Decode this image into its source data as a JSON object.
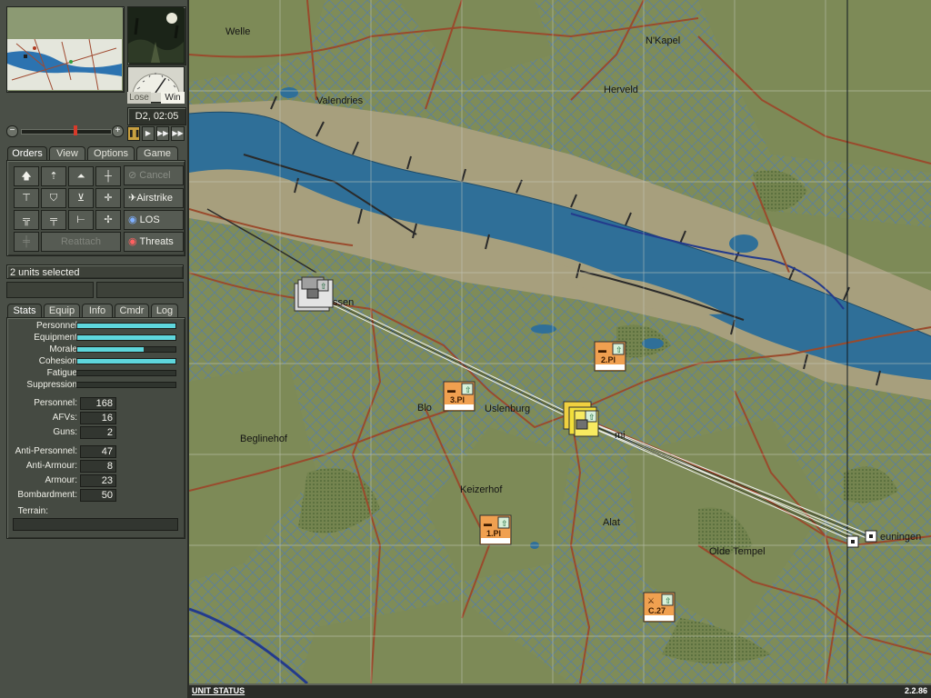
{
  "header": {
    "date_time": "D2, 02:05",
    "lose_label": "Lose",
    "win_label": "Win"
  },
  "speed_controls": [
    "pause",
    "play",
    "fast",
    "fastest"
  ],
  "main_tabs": [
    "Orders",
    "View",
    "Options",
    "Game"
  ],
  "orders": {
    "cancel": "Cancel",
    "airstrike": "Airstrike",
    "los": "LOS",
    "threats": "Threats",
    "reattach": "Reattach"
  },
  "selection": {
    "text": "2 units selected"
  },
  "unit_tabs": [
    "Stats",
    "Equip",
    "Info",
    "Cmdr",
    "Log"
  ],
  "stats_bars": [
    {
      "label": "Personnel",
      "value": 1.0
    },
    {
      "label": "Equipment",
      "value": 1.0
    },
    {
      "label": "Morale",
      "value": 0.68
    },
    {
      "label": "Cohesion",
      "value": 1.0
    },
    {
      "label": "Fatigue",
      "value": 0.0
    },
    {
      "label": "Suppression",
      "value": 0.0
    }
  ],
  "stats_values": [
    {
      "label": "Personnel:",
      "value": "168"
    },
    {
      "label": "AFVs:",
      "value": "16"
    },
    {
      "label": "Guns:",
      "value": "2"
    },
    {
      "label": "Anti-Personnel:",
      "value": "47"
    },
    {
      "label": "Anti-Armour:",
      "value": "8"
    },
    {
      "label": "Armour:",
      "value": "23"
    },
    {
      "label": "Bombardment:",
      "value": "50"
    }
  ],
  "terrain_label": "Terrain:",
  "map": {
    "places": [
      "Welle",
      "Valendries",
      "N'Kapel",
      "Herveld",
      "Blo",
      "Uslenburg",
      "Beglinehof",
      "Keizerhof",
      "Alat",
      "Olde Tempel",
      "euningen",
      "ssen",
      "mi"
    ],
    "units": [
      "1.Pl",
      "2.Pl",
      "3.Pl",
      "C.27"
    ]
  },
  "status_bar": {
    "label": "UNIT STATUS",
    "version": "2.2.86"
  },
  "colors": {
    "panel": "#4a4f47",
    "bar_fill": "#5ed6dc",
    "river": "#2f6f98",
    "road": "#9a4a2c",
    "unit_orange": "#f0a050",
    "unit_yellow": "#f2df3a"
  }
}
